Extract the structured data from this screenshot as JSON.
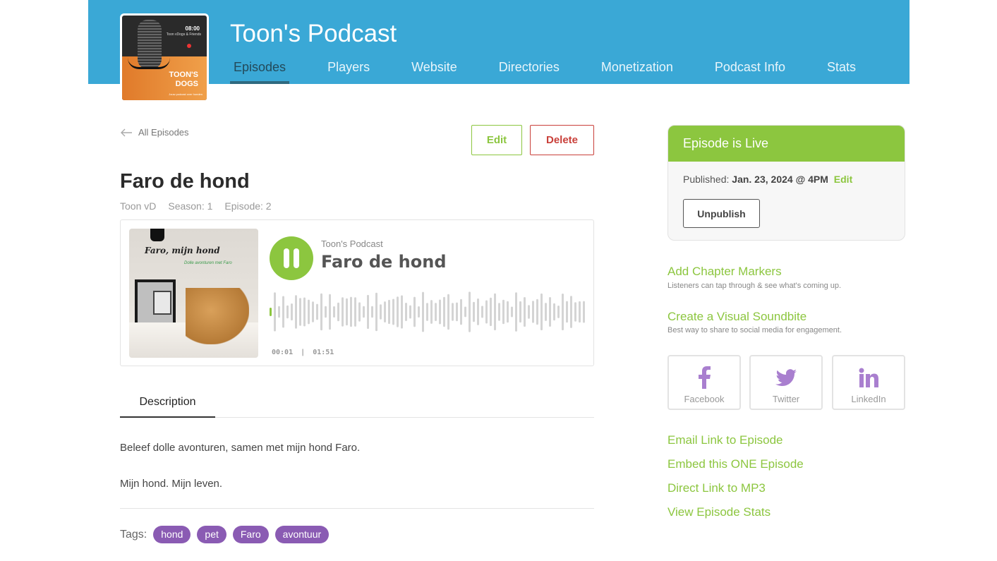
{
  "header": {
    "podcast_title": "Toon's Podcast",
    "cover": {
      "time": "08:00",
      "subtitle": "Toon vDogs & Friends",
      "name": "TOON'S\nDOGS",
      "tagline": "Jouw podcast over honden"
    },
    "nav": [
      {
        "label": "Episodes",
        "active": true
      },
      {
        "label": "Players"
      },
      {
        "label": "Website"
      },
      {
        "label": "Directories"
      },
      {
        "label": "Monetization"
      },
      {
        "label": "Podcast Info"
      },
      {
        "label": "Stats"
      }
    ]
  },
  "back_link": "All Episodes",
  "actions": {
    "edit": "Edit",
    "delete": "Delete"
  },
  "episode": {
    "title": "Faro de hond",
    "author": "Toon vD",
    "season": "Season: 1",
    "episode": "Episode: 2"
  },
  "player": {
    "art_title": "Faro, mijn hond",
    "art_subtitle": "Dolle avonturen met Faro",
    "show": "Toon's Podcast",
    "episode_title": "Faro de hond",
    "current_time": "00:01",
    "separator": "|",
    "duration": "01:51",
    "progress": 0.01,
    "state": "playing"
  },
  "tabs": {
    "description": "Description"
  },
  "description": {
    "line1": "Beleef dolle avonturen, samen met mijn hond Faro.",
    "line2": "Mijn hond. Mijn leven."
  },
  "tags": {
    "label": "Tags:",
    "items": [
      "hond",
      "pet",
      "Faro",
      "avontuur"
    ]
  },
  "status_card": {
    "header": "Episode is Live",
    "published_label": "Published:",
    "published_value": "Jan. 23, 2024 @ 4PM",
    "edit": "Edit",
    "unpublish": "Unpublish"
  },
  "sidebar": {
    "chapter_markers": {
      "label": "Add Chapter Markers",
      "sub": "Listeners can tap through & see what's coming up."
    },
    "soundbite": {
      "label": "Create a Visual Soundbite",
      "sub": "Best way to share to social media for engagement."
    },
    "share": [
      {
        "label": "Facebook",
        "icon": "facebook-icon"
      },
      {
        "label": "Twitter",
        "icon": "twitter-icon"
      },
      {
        "label": "LinkedIn",
        "icon": "linkedin-icon"
      }
    ],
    "links": [
      "Email Link to Episode",
      "Embed this ONE Episode",
      "Direct Link to MP3",
      "View Episode Stats"
    ]
  },
  "colors": {
    "header": "#3aa8d6",
    "accent": "#8cc63f",
    "danger": "#c9403a",
    "tag": "#8a5bb3",
    "social": "#a97fcf"
  }
}
